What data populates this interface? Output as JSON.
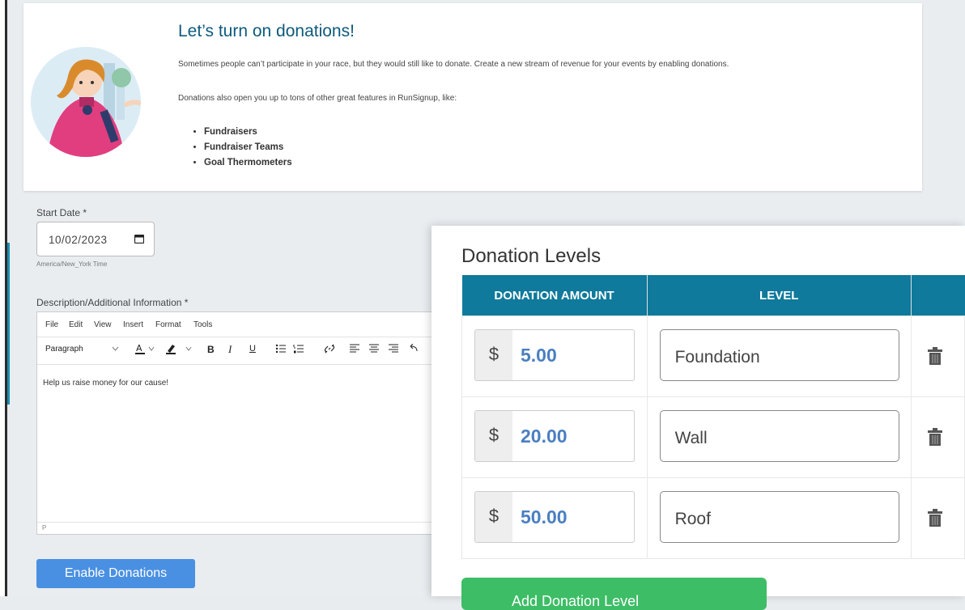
{
  "intro": {
    "title": "Let’s turn on donations!",
    "p1": "Sometimes people can’t participate in your race, but they would still like to donate. Create a new stream of revenue for your events by enabling donations.",
    "p2": "Donations also open you up to tons of other great features in RunSignup, like:",
    "features": [
      "Fundraisers",
      "Fundraiser Teams",
      "Goal Thermometers"
    ]
  },
  "start_date": {
    "label": "Start Date *",
    "value": "10/02/2023",
    "timezone": "America/New_York Time"
  },
  "description": {
    "label": "Description/Additional Information *",
    "menu": [
      "File",
      "Edit",
      "View",
      "Insert",
      "Format",
      "Tools"
    ],
    "block_format": "Paragraph",
    "toolbar_glyphs": {
      "bold": "B",
      "italic": "I",
      "underline": "U"
    },
    "content": "Help us raise money for our cause!",
    "status_path": "P"
  },
  "enable_button": "Enable Donations",
  "donation_levels": {
    "title": "Donation Levels",
    "headers": {
      "amount": "DONATION AMOUNT",
      "level": "LEVEL"
    },
    "currency_symbol": "$",
    "rows": [
      {
        "amount": "5.00",
        "level": "Foundation"
      },
      {
        "amount": "20.00",
        "level": "Wall"
      },
      {
        "amount": "50.00",
        "level": "Roof"
      }
    ],
    "add_button": "Add Donation Level"
  },
  "colors": {
    "header_teal": "#0f7a9b",
    "title_blue": "#0e5a7c",
    "amount_blue": "#4a7fc1",
    "enable_blue": "#4a90e2",
    "add_green": "#3dbd66"
  },
  "icons": [
    "calendar-icon",
    "trash-icon",
    "chevron-down-icon",
    "link-icon",
    "text-color-icon",
    "highlight-icon"
  ]
}
